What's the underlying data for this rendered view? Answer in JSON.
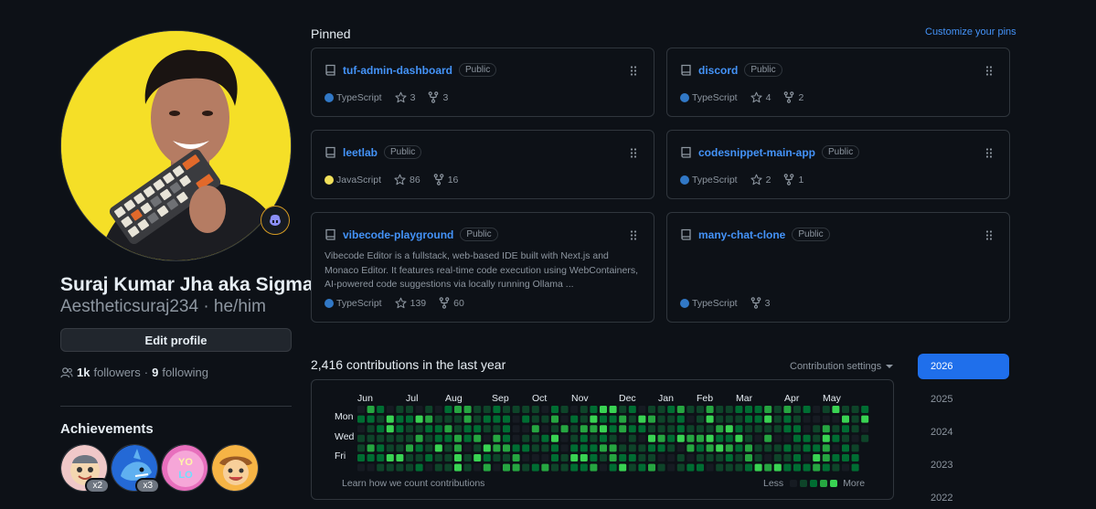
{
  "profile": {
    "name": "Suraj Kumar Jha aka Sigma",
    "login": "Aestheticsuraj234 · he/him",
    "edit_label": "Edit profile",
    "followers_count": "1k",
    "followers_label": "followers",
    "separator": "·",
    "following_count": "9",
    "following_label": "following"
  },
  "achievements": {
    "title": "Achievements",
    "badges": [
      {
        "icon": "pull-shark-icon",
        "count": "x2"
      },
      {
        "icon": "pair-extraordinaire-icon",
        "count": "x3"
      },
      {
        "icon": "yolo-icon",
        "count": ""
      },
      {
        "icon": "quickdraw-icon",
        "count": ""
      }
    ]
  },
  "pinned": {
    "title": "Pinned",
    "customize_label": "Customize your pins",
    "repos": [
      {
        "name": "tuf-admin-dashboard",
        "visibility": "Public",
        "language": "TypeScript",
        "lang_color": "#3178c6",
        "stars": "3",
        "forks": "3",
        "description": ""
      },
      {
        "name": "discord",
        "visibility": "Public",
        "language": "TypeScript",
        "lang_color": "#3178c6",
        "stars": "4",
        "forks": "2",
        "description": ""
      },
      {
        "name": "leetlab",
        "visibility": "Public",
        "language": "JavaScript",
        "lang_color": "#f1e05a",
        "stars": "86",
        "forks": "16",
        "description": ""
      },
      {
        "name": "codesnippet-main-app",
        "visibility": "Public",
        "language": "TypeScript",
        "lang_color": "#3178c6",
        "stars": "2",
        "forks": "1",
        "description": ""
      },
      {
        "name": "vibecode-playground",
        "visibility": "Public",
        "language": "TypeScript",
        "lang_color": "#3178c6",
        "stars": "139",
        "forks": "60",
        "description": "Vibecode Editor is a fullstack, web-based IDE built with Next.js and Monaco Editor. It features real-time code execution using WebContainers, AI-powered code suggestions via locally running Ollama ..."
      },
      {
        "name": "many-chat-clone",
        "visibility": "Public",
        "language": "TypeScript",
        "lang_color": "#3178c6",
        "stars": "",
        "forks": "3",
        "description": ""
      }
    ]
  },
  "contributions": {
    "title": "2,416 contributions in the last year",
    "settings_label": "Contribution settings",
    "months": [
      "Jun",
      "Jul",
      "Aug",
      "Sep",
      "Oct",
      "Nov",
      "Dec",
      "Jan",
      "Feb",
      "Mar",
      "Apr",
      "May"
    ],
    "days": [
      "Mon",
      "Wed",
      "Fri"
    ],
    "learn_label": "Learn how we count contributions",
    "legend_less": "Less",
    "legend_more": "More",
    "levels": [
      "#161b22",
      "#0e4429",
      "#006d32",
      "#26a641",
      "#39d353"
    ]
  },
  "years": [
    "2026",
    "2025",
    "2024",
    "2023",
    "2022"
  ],
  "active_year": "2026"
}
